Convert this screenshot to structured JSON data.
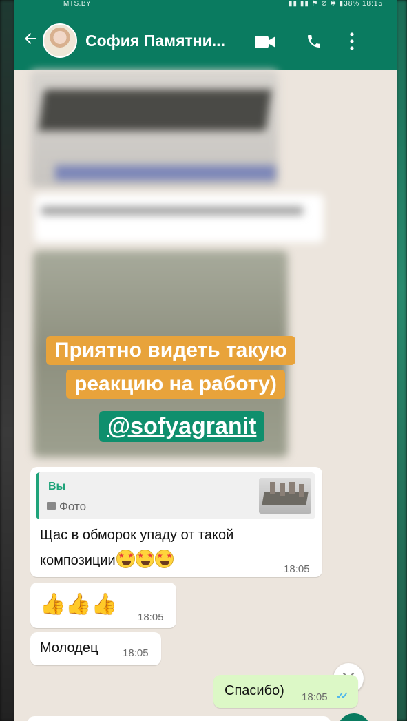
{
  "status_bar": {
    "carrier": "MTS.BY",
    "right_text": "▮▮ ▮▮ ⚑ ⊘ ✱ ▮38% 18:15"
  },
  "header": {
    "contact_name": "София Памятни..."
  },
  "overlay": {
    "caption_line1": "Приятно видеть такую",
    "caption_line2": "реакцию на работу)",
    "handle": "@sofyagranit"
  },
  "messages": [
    {
      "direction": "in",
      "quote_author": "Вы",
      "quote_kind": "Фото",
      "line1": "Щас в обморок упаду от такой",
      "line2": "композиции",
      "time": "18:05"
    },
    {
      "direction": "in",
      "emoji": "👍👍👍",
      "time": "18:05"
    },
    {
      "direction": "in",
      "text": "Молодец",
      "time": "18:05"
    },
    {
      "direction": "out",
      "text": "Спасибо)",
      "time": "18:05",
      "status": "read"
    }
  ],
  "colors": {
    "header": "#0a7b60",
    "chat_bg": "#ece5dd",
    "outgoing": "#dcf8c6",
    "caption": "#e8a33b",
    "handle_bg": "#0f8f6d",
    "read_ticks": "#4fb6ec"
  }
}
